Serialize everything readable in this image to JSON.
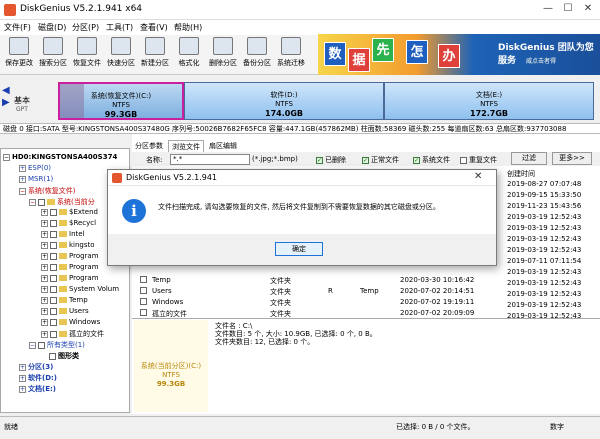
{
  "window": {
    "title": "DiskGenius V5.2.1.941 x64",
    "minimize": "—",
    "maximize": "☐",
    "close": "✕"
  },
  "menu": [
    "文件(F)",
    "磁盘(D)",
    "分区(P)",
    "工具(T)",
    "查看(V)",
    "帮助(H)"
  ],
  "toolbar": [
    "保存更改",
    "搜索分区",
    "恢复文件",
    "快速分区",
    "新建分区",
    "格式化",
    "删除分区",
    "备份分区",
    "系统迁移"
  ],
  "banner": {
    "tiles": [
      "数",
      "据",
      "先",
      "怎",
      "办"
    ],
    "tile_colors": [
      "#1f5fbf",
      "#e0403a",
      "#2bb24c",
      "#1f5fbf",
      "#e0403a"
    ],
    "slogan": "DiskGenius 团队为您服务",
    "sub": "威点击者得"
  },
  "disk": {
    "label": "基本",
    "type": "GPT"
  },
  "partitions": [
    {
      "name": "系统(恢复文件)(C:)",
      "fs": "NTFS",
      "size": "99.3GB"
    },
    {
      "name": "软件(D:)",
      "fs": "NTFS",
      "size": "174.0GB"
    },
    {
      "name": "文档(E:)",
      "fs": "NTFS",
      "size": "172.7GB"
    }
  ],
  "disk_info": "磁盘 0 接口:SATA  型号:KINGSTONSA400S37480G  序列号:50026B7682F65FC8  容量:447.1GB(457862MB)  柱面数:58369  磁头数:255  每道扇区数:63  总扇区数:937703088",
  "tree": [
    {
      "text": "HD0:KINGSTONSA400S374",
      "cls": ""
    },
    {
      "text": "ESP(0)",
      "cls": "blue"
    },
    {
      "text": "MSR(1)",
      "cls": "blue"
    },
    {
      "text": "系统(恢复文件)",
      "cls": "red"
    },
    {
      "text": "系统(当前分",
      "cls": "red"
    },
    {
      "text": "$Extend",
      "cls": ""
    },
    {
      "text": "$Recycl",
      "cls": ""
    },
    {
      "text": "Intel",
      "cls": ""
    },
    {
      "text": "kingsto",
      "cls": ""
    },
    {
      "text": "Program",
      "cls": ""
    },
    {
      "text": "Program",
      "cls": ""
    },
    {
      "text": "Program",
      "cls": ""
    },
    {
      "text": "System Volum",
      "cls": ""
    },
    {
      "text": "Temp",
      "cls": ""
    },
    {
      "text": "Users",
      "cls": ""
    },
    {
      "text": "Windows",
      "cls": ""
    },
    {
      "text": "孤立的文件",
      "cls": ""
    },
    {
      "text": "所有类型(1)",
      "cls": "blue"
    },
    {
      "text": "图形类",
      "cls": ""
    },
    {
      "text": "分区(3)",
      "cls": "blue"
    },
    {
      "text": "软件(D:)",
      "cls": "blue"
    },
    {
      "text": "文档(E:)",
      "cls": "blue"
    }
  ],
  "tabs": [
    "分区参数",
    "浏览文件",
    "扇区编辑"
  ],
  "filter": {
    "name_label": "名称:",
    "name_value": "*.*",
    "ext": "(*.jpg;*.bmp)",
    "checks": [
      "已删除",
      "正常文件",
      "系统文件",
      "重复文件"
    ],
    "filter_btn": "过滤",
    "more_btn": "更多>>"
  },
  "date_header": "创建时间",
  "dates": [
    "2019-08-27 07:07:48",
    "2019-09-15 15:33:50",
    "2019-11-23 15:43:56",
    "2019-03-19 12:52:43",
    "2019-03-19 12:52:43",
    "2019-03-19 12:52:43",
    "2019-03-19 12:52:43",
    "2019-07-11 07:11:54",
    "2019-03-19 12:52:43",
    "2019-03-19 12:52:43",
    "2019-03-19 12:52:43",
    "2019-03-19 12:52:43",
    "2019-03-19 12:52:43"
  ],
  "files": [
    {
      "name": "Temp",
      "type": "文件夹",
      "attr": "",
      "short": "",
      "modified": "2020-03-30 10:16:42"
    },
    {
      "name": "Users",
      "type": "文件夹",
      "attr": "R",
      "short": "Temp",
      "modified": "2020-07-02 20:14:51"
    },
    {
      "name": "Windows",
      "type": "文件夹",
      "attr": "",
      "short": "",
      "modified": "2020-07-02 19:19:11"
    },
    {
      "name": "孤立的文件",
      "type": "文件夹",
      "attr": "",
      "short": "",
      "modified": "2020-07-02 20:09:09"
    }
  ],
  "info": {
    "card_name": "系统(当前分区)(C:)",
    "card_fs": "NTFS",
    "card_size": "99.3GB",
    "lines": [
      "文件名 : C:\\",
      "文件数目: 5 个, 大小: 10.9GB, 已选择: 0 个, 0 B。",
      "文件夹数目: 12, 已选择: 0 个。"
    ]
  },
  "status": {
    "left": "就绪",
    "mid": "已选择: 0 B / 0 个文件。",
    "right": "数字"
  },
  "dialog": {
    "title": "DiskGenius V5.2.1.941",
    "icon": "i",
    "message": "文件扫描完成, 请勾选要恢复的文件, 然后将文件复制到不需要恢复数据的其它磁盘或分区。",
    "ok": "确定",
    "close": "✕"
  }
}
